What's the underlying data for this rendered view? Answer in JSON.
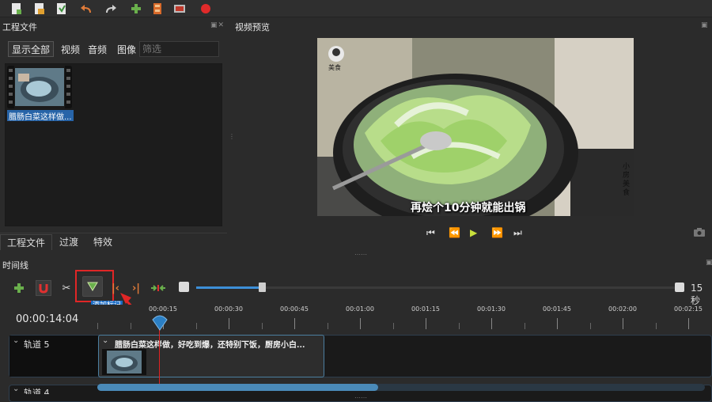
{
  "toolbar": {
    "icons": [
      "new-project-icon",
      "open-project-icon",
      "save-project-icon",
      "undo-icon",
      "redo-icon",
      "add-files-icon",
      "import-video-icon",
      "export-film-icon",
      "record-icon"
    ]
  },
  "project_panel": {
    "title": "工程文件",
    "filters": [
      "显示全部",
      "视频",
      "音频",
      "图像"
    ],
    "filter_placeholder": "筛选",
    "file": {
      "label": "腊肠白菜这样做..."
    },
    "bottom_tabs": [
      "工程文件",
      "过渡",
      "特效"
    ]
  },
  "preview_panel": {
    "title": "视频预览",
    "subtitle": "再烩个10分钟就能出锅",
    "logo_text": "美食",
    "watermark": "小房美食"
  },
  "timeline": {
    "title": "时间线",
    "tooltip": "添加标记",
    "zoom_label": "15秒",
    "current_time": "00:00:14:04",
    "ruler_labels": [
      "00:00:15",
      "00:00:30",
      "00:00:45",
      "00:01:00",
      "00:01:15",
      "00:01:30",
      "00:01:45",
      "00:02:00",
      "00:02:15"
    ],
    "tracks": [
      {
        "name": "轨道 5",
        "clip_title": "腊肠白菜这样做，好吃到爆，还特别下饭，厨房小白..."
      },
      {
        "name": "轨道 4"
      }
    ]
  },
  "colors": {
    "accent": "#3d8fd8",
    "highlight": "#e02626",
    "playhead": "#e02222"
  }
}
